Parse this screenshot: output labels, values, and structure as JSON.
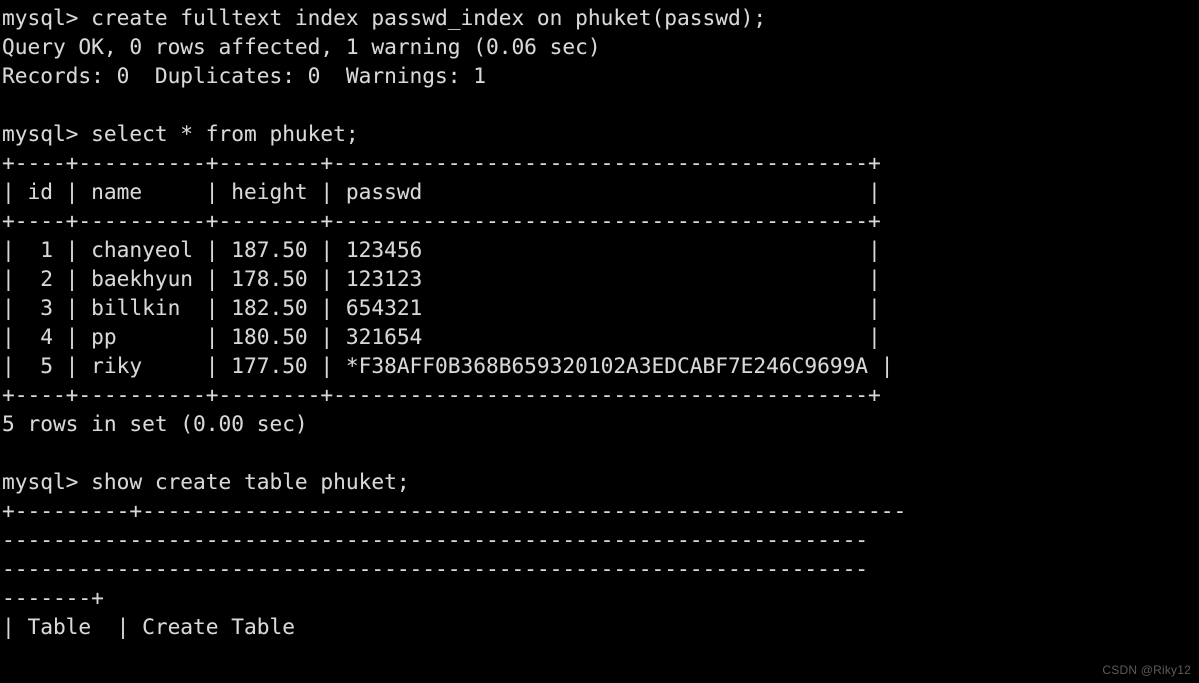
{
  "terminal": {
    "title": "MySQL command line client",
    "prompt": "mysql>",
    "background_color": "#000000",
    "text_color": "#d8d8d8",
    "lines": [
      "mysql> create fulltext index passwd_index on phuket(passwd);",
      "Query OK, 0 rows affected, 1 warning (0.06 sec)",
      "Records: 0  Duplicates: 0  Warnings: 1",
      "",
      "mysql> select * from phuket;",
      "+----+----------+--------+------------------------------------------+",
      "| id | name     | height | passwd                                   |",
      "+----+----------+--------+------------------------------------------+",
      "|  1 | chanyeol | 187.50 | 123456                                   |",
      "|  2 | baekhyun | 178.50 | 123123                                   |",
      "|  3 | billkin  | 182.50 | 654321                                   |",
      "|  4 | pp       | 180.50 | 321654                                   |",
      "|  5 | riky     | 177.50 | *F38AFF0B368B659320102A3EDCABF7E246C9699A |",
      "+----+----------+--------+------------------------------------------+",
      "5 rows in set (0.00 sec)",
      "",
      "mysql> show create table phuket;",
      "+---------+------------------------------------------------------------",
      "--------------------------------------------------------------------",
      "--------------------------------------------------------------------",
      "-------+",
      "| Table  | Create Table"
    ],
    "statements": [
      {
        "sql": "create fulltext index passwd_index on phuket(passwd);",
        "result": "Query OK, 0 rows affected, 1 warning (0.06 sec)",
        "detail": "Records: 0  Duplicates: 0  Warnings: 1"
      },
      {
        "sql": "select * from phuket;",
        "result": "5 rows in set (0.00 sec)"
      },
      {
        "sql": "show create table phuket;",
        "result": ""
      }
    ]
  },
  "result_table": {
    "columns": [
      "id",
      "name",
      "height",
      "passwd"
    ],
    "rows": [
      [
        "1",
        "chanyeol",
        "187.50",
        "123456"
      ],
      [
        "2",
        "baekhyun",
        "178.50",
        "123123"
      ],
      [
        "3",
        "billkin",
        "182.50",
        "654321"
      ],
      [
        "4",
        "pp",
        "180.50",
        "321654"
      ],
      [
        "5",
        "riky",
        "177.50",
        "*F38AFF0B368B659320102A3EDCABF7E246C9699A"
      ]
    ],
    "row_count_text": "5 rows in set (0.00 sec)"
  },
  "create_table_output": {
    "columns": [
      "Table",
      "Create Table"
    ]
  },
  "watermark": {
    "text": "CSDN @Riky12"
  }
}
